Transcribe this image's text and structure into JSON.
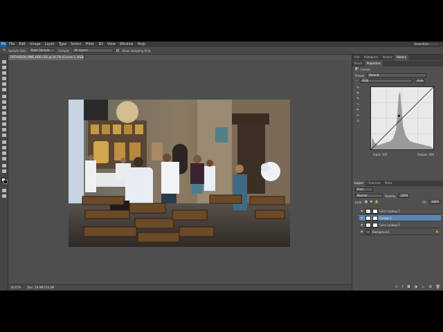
{
  "menubar": {
    "logo": "Ps",
    "items": [
      "File",
      "Edit",
      "Image",
      "Layer",
      "Type",
      "Select",
      "Filter",
      "3D",
      "View",
      "Window",
      "Help"
    ],
    "workspace": "Essentials"
  },
  "options": {
    "sample_size_label": "Sample Size:",
    "sample_size_value": "Point Sample",
    "sample_label": "Sample:",
    "sample_value": "All Layers",
    "show_ring_label": "Show Sampling Ring"
  },
  "document": {
    "tab_title": "ORTHODOX_PINE_HDR.CR2 @ 16.7% (Curves 1, RGB/16) *",
    "zoom": "16.67%",
    "doc_size": "Doc: 28.9M/110.4M"
  },
  "right_panel": {
    "top_tabs": [
      "Info",
      "Histogram",
      "Actions",
      "History"
    ],
    "prop_tabs": [
      "Brush",
      "Properties"
    ],
    "prop_title": "Curves",
    "preset_label": "Preset:",
    "preset_value": "Default",
    "channel_value": "RGB",
    "auto_label": "Auto",
    "input_label": "Input:",
    "input_value": "122",
    "output_label": "Output:",
    "output_value": "166"
  },
  "layers_panel": {
    "tabs": [
      "Layers",
      "Channels",
      "Paths"
    ],
    "kind_label": "Kind",
    "blend_mode": "Normal",
    "opacity_label": "Opacity:",
    "opacity_value": "100%",
    "lock_label": "Lock:",
    "fill_label": "Fill:",
    "fill_value": "100%",
    "layers": [
      {
        "name": "Color Lookup 2",
        "selected": false
      },
      {
        "name": "Curves 1",
        "selected": true
      },
      {
        "name": "Color Lookup 1",
        "selected": false
      },
      {
        "name": "Background",
        "selected": false
      }
    ]
  },
  "colors": {
    "accent": "#5b86b3",
    "ui_bg": "#535353",
    "panel_bg": "#505050"
  }
}
